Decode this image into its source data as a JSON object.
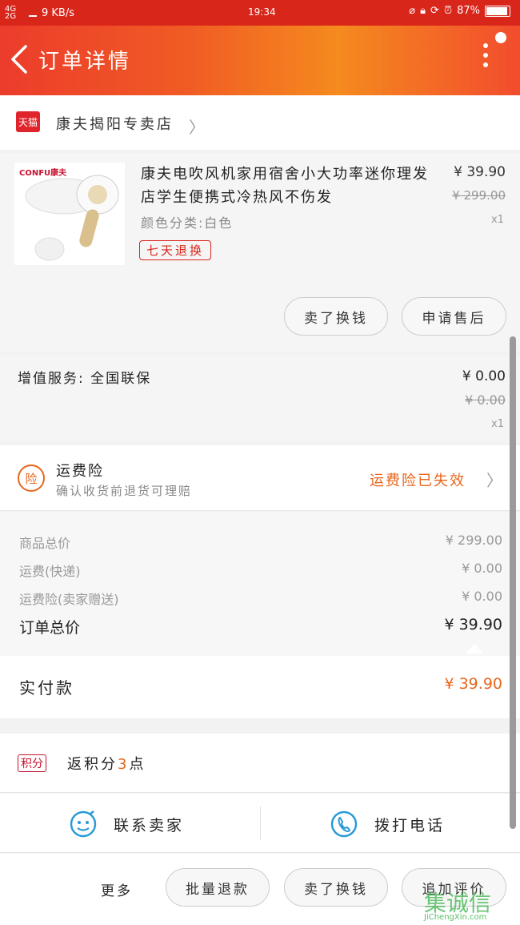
{
  "status_bar": {
    "network": "4G 2G",
    "speed": "9 KB/s",
    "time": "19:34",
    "battery": "87%",
    "battery_level": 0.87
  },
  "header": {
    "title": "订单详情"
  },
  "shop": {
    "badge": "天猫",
    "name": "康夫揭阳专卖店"
  },
  "product": {
    "brand": "CONFU康夫",
    "title": "康夫电吹风机家用宿舍小大功率迷你理发店学生便携式冷热风不伤发",
    "price": "¥ 39.90",
    "original_price": "¥ 299.00",
    "quantity": "x1",
    "spec": "颜色分类:白色",
    "tag": "七天退换",
    "buttons": {
      "resell": "卖了换钱",
      "after_sale": "申请售后"
    }
  },
  "service": {
    "label": "增值服务: 全国联保",
    "price": "¥ 0.00",
    "original_price": "¥ 0.00",
    "quantity": "x1"
  },
  "insurance": {
    "badge": "险",
    "title": "运费险",
    "subtitle": "确认收货前退货可理赔",
    "status": "运费险已失效"
  },
  "summary": {
    "rows": [
      {
        "label": "商品总价",
        "value": "¥ 299.00"
      },
      {
        "label": "运费(快递)",
        "value": "¥ 0.00"
      },
      {
        "label": "运费险(卖家赠送)",
        "value": "¥ 0.00"
      }
    ],
    "total_label": "订单总价",
    "total_value": "¥ 39.90"
  },
  "paid": {
    "label": "实付款",
    "value": "¥ 39.90"
  },
  "points": {
    "tag": "积分",
    "prefix": "返积分",
    "count": "3",
    "suffix": "点"
  },
  "contact": {
    "seller": "联系卖家",
    "call": "拨打电话"
  },
  "bottom_bar": {
    "more": "更多",
    "batch_refund": "批量退款",
    "resell": "卖了换钱",
    "review": "追加评价"
  },
  "watermark": {
    "main": "集诚信",
    "domain": "JiChengXin.com"
  },
  "colors": {
    "primary_red": "#d9261b",
    "accent_orange": "#e8651a",
    "tmall_red": "#e0242b"
  }
}
